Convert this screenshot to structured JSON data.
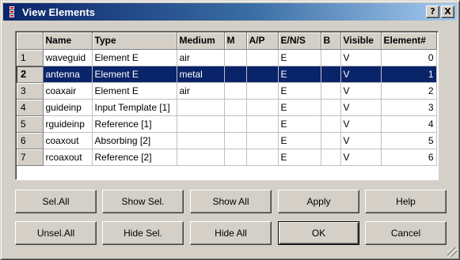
{
  "window": {
    "title": "View Elements",
    "help_glyph": "?",
    "close_glyph": "X"
  },
  "table": {
    "columns": [
      "",
      "Name",
      "Type",
      "Medium",
      "M",
      "A/P",
      "E/N/S",
      "B",
      "Visible",
      "Element#"
    ],
    "rows": [
      {
        "row": "1",
        "name": "waveguid",
        "type": "Element E",
        "medium": "air",
        "m": "",
        "ap": "",
        "ens": "E",
        "b": "",
        "visible": "V",
        "element": "0"
      },
      {
        "row": "2",
        "name": "antenna",
        "type": "Element E",
        "medium": "metal",
        "m": "",
        "ap": "",
        "ens": "E",
        "b": "",
        "visible": "V",
        "element": "1"
      },
      {
        "row": "3",
        "name": "coaxair",
        "type": "Element E",
        "medium": "air",
        "m": "",
        "ap": "",
        "ens": "E",
        "b": "",
        "visible": "V",
        "element": "2"
      },
      {
        "row": "4",
        "name": "guideinp",
        "type": "Input Template [1]",
        "medium": "",
        "m": "",
        "ap": "",
        "ens": "E",
        "b": "",
        "visible": "V",
        "element": "3"
      },
      {
        "row": "5",
        "name": "rguideinp",
        "type": "Reference [1]",
        "medium": "",
        "m": "",
        "ap": "",
        "ens": "E",
        "b": "",
        "visible": "V",
        "element": "4"
      },
      {
        "row": "6",
        "name": "coaxout",
        "type": "Absorbing [2]",
        "medium": "",
        "m": "",
        "ap": "",
        "ens": "E",
        "b": "",
        "visible": "V",
        "element": "5"
      },
      {
        "row": "7",
        "name": "rcoaxout",
        "type": "Reference [2]",
        "medium": "",
        "m": "",
        "ap": "",
        "ens": "E",
        "b": "",
        "visible": "V",
        "element": "6"
      }
    ],
    "selected_row": "2"
  },
  "buttons": {
    "sel_all": "Sel.All",
    "show_sel": "Show Sel.",
    "show_all": "Show All",
    "apply": "Apply",
    "help": "Help",
    "unsel_all": "Unsel.All",
    "hide_sel": "Hide Sel.",
    "hide_all": "Hide All",
    "ok": "OK",
    "cancel": "Cancel"
  },
  "colors": {
    "selection": "#0a246a",
    "face": "#d4d0c8"
  }
}
